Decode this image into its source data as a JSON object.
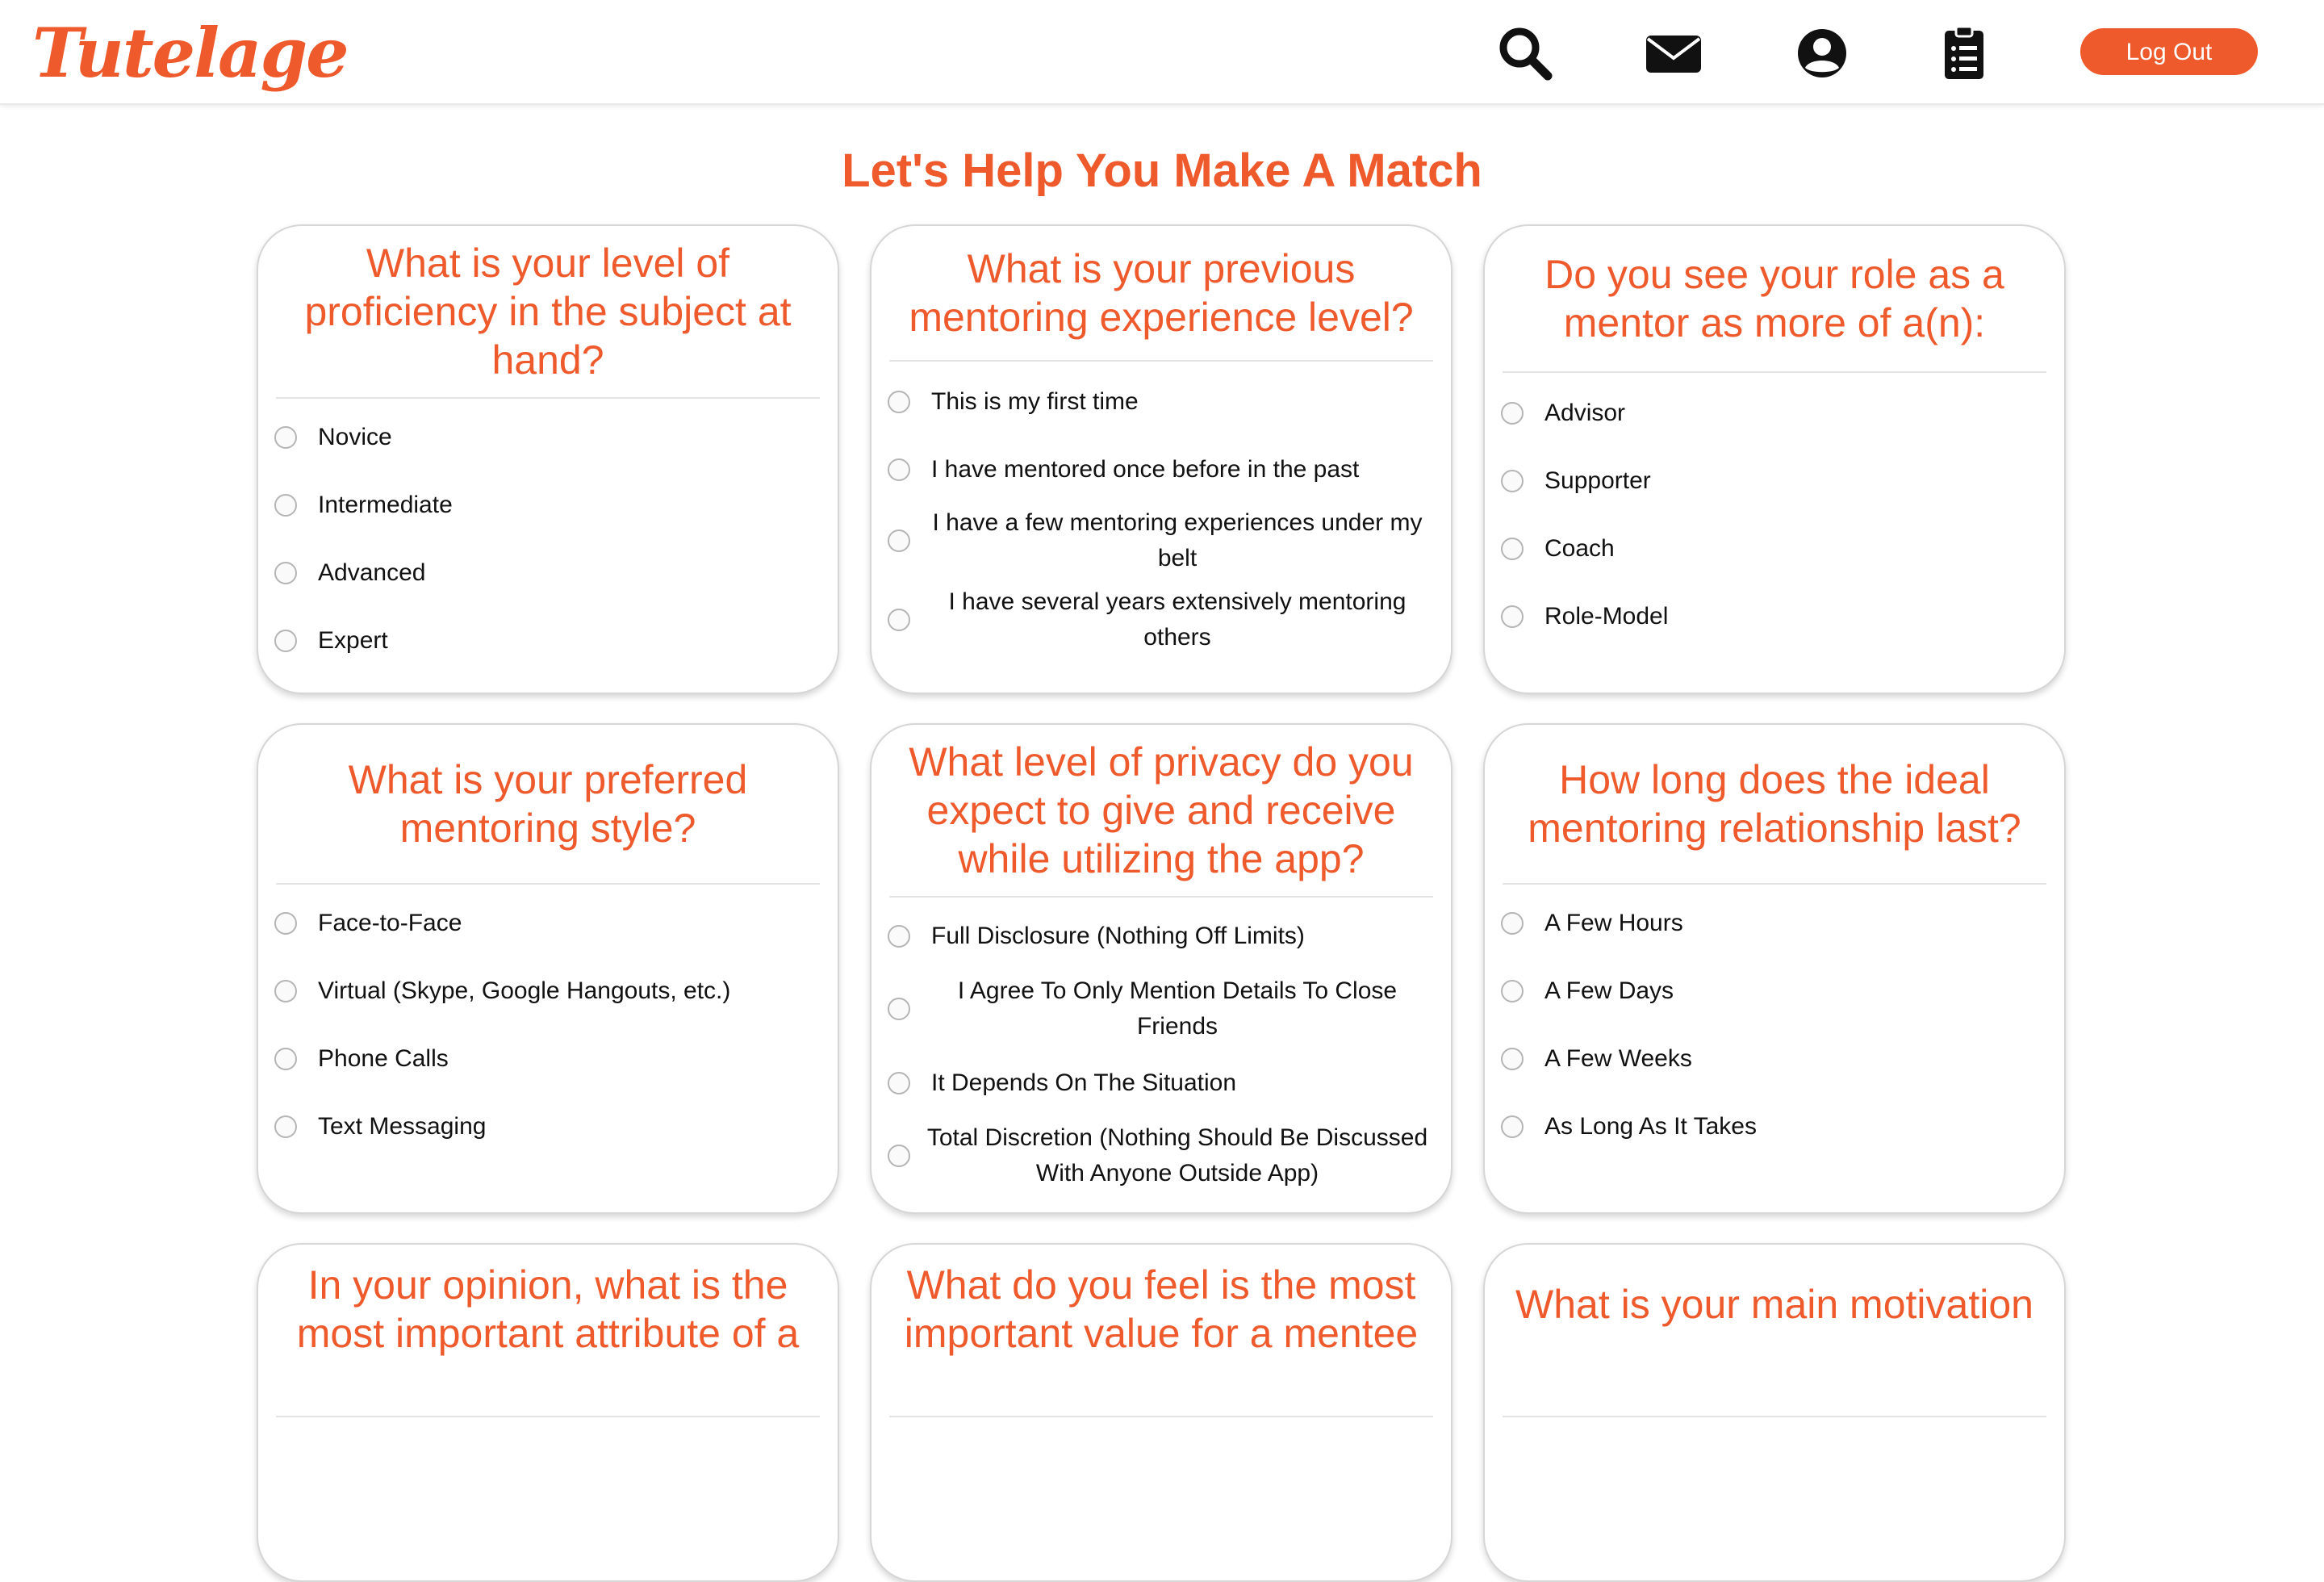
{
  "brand": {
    "logo": "Tutelage",
    "accent": "#ee5a2b"
  },
  "nav": {
    "icons": [
      "search-icon",
      "envelope-icon",
      "user-circle-icon",
      "clipboard-list-icon"
    ],
    "logout_label": "Log Out"
  },
  "page": {
    "title": "Let's Help You Make A Match"
  },
  "questions": [
    {
      "title": "What is your level of proficiency in the subject at hand?",
      "options": [
        "Novice",
        "Intermediate",
        "Advanced",
        "Expert"
      ]
    },
    {
      "title": "What is your previous mentoring experience level?",
      "options": [
        "This is my first time",
        "I have mentored once before in the past",
        "I have a few mentoring experiences under my belt",
        "I have several years extensively mentoring others"
      ]
    },
    {
      "title": "Do you see your role as a mentor as more of a(n):",
      "options": [
        "Advisor",
        "Supporter",
        "Coach",
        "Role-Model"
      ]
    },
    {
      "title": "What is your preferred mentoring style?",
      "options": [
        "Face-to-Face",
        "Virtual (Skype, Google Hangouts, etc.)",
        "Phone Calls",
        "Text Messaging"
      ]
    },
    {
      "title": "What level of privacy do you expect to give and receive while utilizing the app?",
      "options": [
        "Full Disclosure (Nothing Off Limits)",
        "I Agree To Only Mention Details To Close Friends",
        "It Depends On The Situation",
        "Total Discretion (Nothing Should Be Discussed With Anyone Outside App)"
      ]
    },
    {
      "title": "How long does the ideal mentoring relationship last?",
      "options": [
        "A Few Hours",
        "A Few Days",
        "A Few Weeks",
        "As Long As It Takes"
      ]
    },
    {
      "title": "In your opinion, what is the most important attribute of a"
    },
    {
      "title": "What do you feel is the most important value for a mentee"
    },
    {
      "title": "What is your main motivation"
    }
  ]
}
